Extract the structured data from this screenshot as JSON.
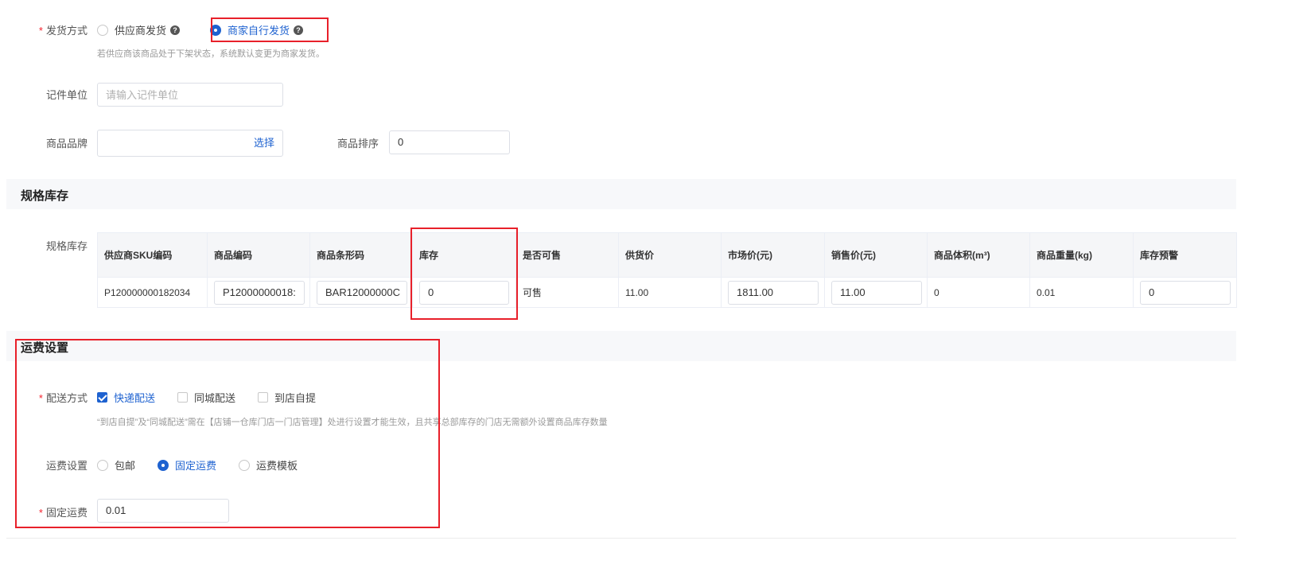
{
  "shipping_method": {
    "label": "发货方式",
    "options": [
      "供应商发货",
      "商家自行发货"
    ],
    "selected": "商家自行发货",
    "hint": "若供应商该商品处于下架状态，系统默认变更为商家发货。"
  },
  "unit": {
    "label": "记件单位",
    "placeholder": "请输入记件单位",
    "value": ""
  },
  "brand": {
    "label": "商品品牌",
    "select_link": "选择",
    "value": ""
  },
  "sort": {
    "label": "商品排序",
    "value": "0"
  },
  "spec_section": {
    "title": "规格库存",
    "row_label": "规格库存",
    "columns": [
      "供应商SKU编码",
      "商品编码",
      "商品条形码",
      "库存",
      "是否可售",
      "供货价",
      "市场价(元)",
      "销售价(元)",
      "商品体积(m³)",
      "商品重量(kg)",
      "库存预警"
    ],
    "rows": [
      {
        "supplier_sku": "P120000000182034",
        "product_code": "P12000000018:",
        "barcode": "BAR12000000C",
        "stock": "0",
        "sellable": "可售",
        "supply_price": "11.00",
        "market_price": "1811.00",
        "sale_price": "11.00",
        "volume": "0",
        "weight": "0.01",
        "stock_alert": "0"
      }
    ]
  },
  "freight_section": {
    "title": "运费设置",
    "delivery": {
      "label": "配送方式",
      "options": [
        "快递配送",
        "同城配送",
        "到店自提"
      ],
      "checked": [
        "快递配送"
      ],
      "hint": "“到店自提”及“同城配送”需在【店铺一仓库门店一门店管理】处进行设置才能生效，且共享总部库存的门店无需额外设置商品库存数量"
    },
    "freight": {
      "label": "运费设置",
      "options": [
        "包邮",
        "固定运费",
        "运费模板"
      ],
      "selected": "固定运费"
    },
    "fixed_fee": {
      "label": "固定运费",
      "value": "0.01"
    }
  },
  "colors": {
    "accent": "#1e62d0",
    "required": "#f5222d",
    "highlight_box": "#e8202a"
  }
}
